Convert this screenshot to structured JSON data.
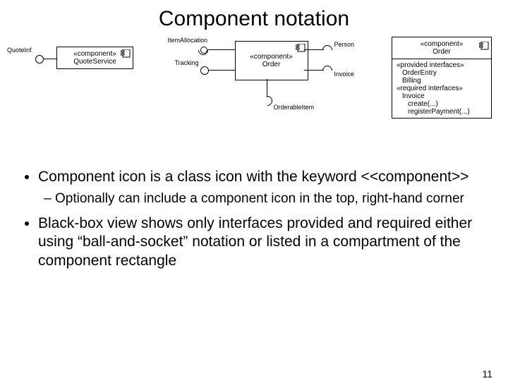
{
  "title": "Component notation",
  "diagram1": {
    "iface_label": "QuoteInf",
    "stereotype": "«component»",
    "name": "QuoteService"
  },
  "diagram2": {
    "left_top": "ItemAllocation",
    "left_bottom": "Tracking",
    "right_top": "Person",
    "right_bottom": "Invoice",
    "bottom": "OrderableItem",
    "stereotype": "«component»",
    "name": "Order"
  },
  "diagram3": {
    "stereotype": "«component»",
    "name": "Order",
    "prov_hdr": "«provided interfaces»",
    "prov1": "OrderEntry",
    "prov2": "Billing",
    "req_hdr": "«required interfaces»",
    "req1": "Invoice",
    "req2": "create(...)",
    "req3": "registerPayment(...)"
  },
  "bullets": {
    "b1": "Component icon is a class icon with the keyword <<component>>",
    "b1a": "Optionally can include a component icon in the top, right-hand corner",
    "b2": "Black-box view shows only interfaces provided and required either using “ball-and-socket” notation or listed in a compartment of the component rectangle"
  },
  "page": "11"
}
